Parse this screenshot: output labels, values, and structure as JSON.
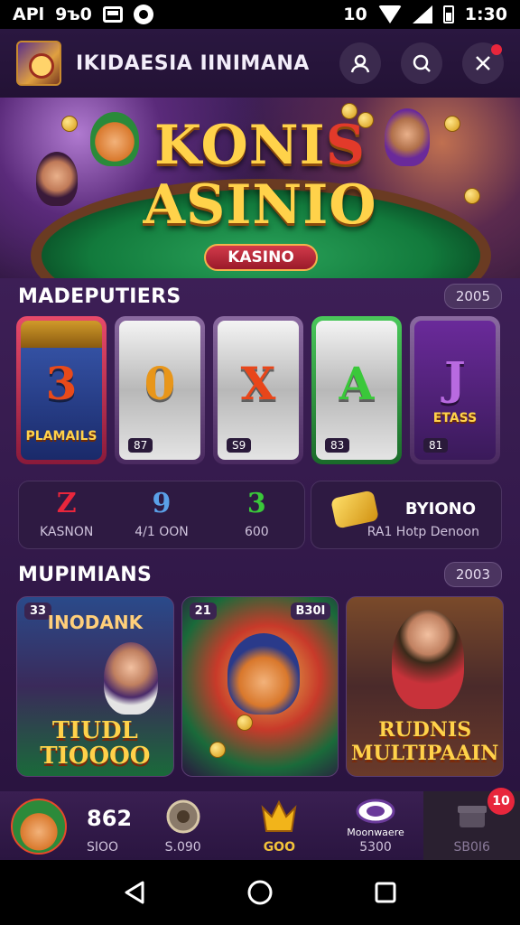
{
  "status_bar": {
    "left_text": "APl",
    "left_icon_text": "9ъ0",
    "time": "1:30",
    "extra": "10"
  },
  "header": {
    "title": "IKIDAESIA IINIMANA",
    "icons": [
      "user-icon",
      "search-icon",
      "close-icon"
    ]
  },
  "hero": {
    "line1_a": "KONI",
    "line1_b": "S",
    "line2": "ASINIO",
    "chip": "KASINO"
  },
  "section1": {
    "title": "MADEPUTIERS",
    "badge": "2005",
    "reels": [
      {
        "symbol": "3",
        "caption": "PLAMAILS",
        "foot": "",
        "color": "#e84a1a"
      },
      {
        "symbol": "0",
        "caption": "",
        "foot": "87",
        "color": "#e8961a"
      },
      {
        "symbol": "X",
        "caption": "",
        "foot": "S9",
        "color": "#e8461a"
      },
      {
        "symbol": "A",
        "caption": "",
        "foot": "83",
        "color": "#3ac83a"
      },
      {
        "symbol": "J",
        "caption": "ETASS",
        "foot": "81",
        "color": "#b86ae0"
      }
    ]
  },
  "stats": {
    "cells": [
      {
        "value": "Z",
        "label": "KASNON",
        "color": "#e8263c"
      },
      {
        "value": "9",
        "label": "4/1 OON",
        "color": "#5aa0e8"
      },
      {
        "value": "3",
        "label": "600",
        "color": "#3ac83a"
      }
    ],
    "bonus_title": "BYIONO",
    "bonus_sub": "RA1 Hotp Denoon"
  },
  "section2": {
    "title": "MUPIMIANS",
    "badge": "2003",
    "cards": [
      {
        "tag": "33",
        "sign": "INODANK",
        "title": "TIUDL TIOOOO"
      },
      {
        "tag": "21",
        "tag_right": "B30I",
        "sign": "",
        "title": ""
      },
      {
        "tag": "",
        "sign": "",
        "title": "RUDNIS MULTIPAAIN"
      }
    ]
  },
  "bottom_nav": {
    "profile_value": "862",
    "profile_sub": "SIOO",
    "items": [
      {
        "label": "S.090",
        "icon": "wheel-icon"
      },
      {
        "label": "GOO",
        "icon": "crown-icon"
      },
      {
        "label": "5300",
        "icon": "chip-icon",
        "sub": "Moonwaere"
      },
      {
        "label": "SB0I6",
        "icon": "gift-icon",
        "badge": "10"
      }
    ]
  },
  "colors": {
    "accent_gold": "#ffd24a",
    "bg_purple": "#3d1f56",
    "alert_red": "#e8263c"
  }
}
